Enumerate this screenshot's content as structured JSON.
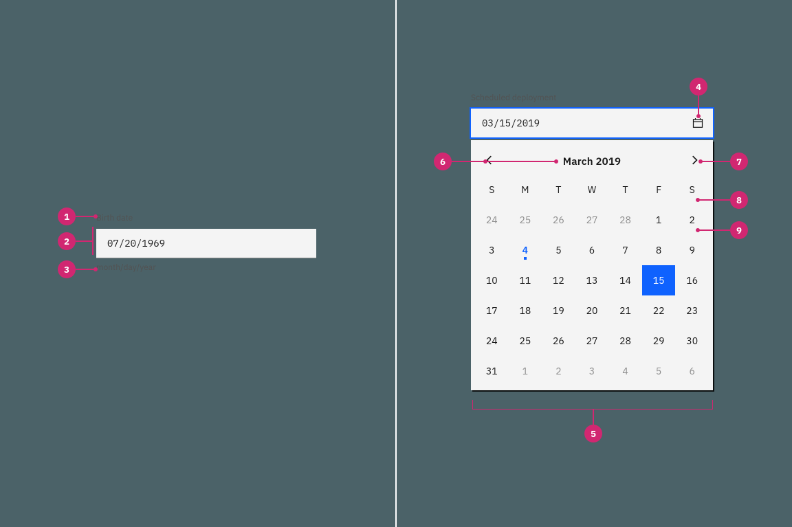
{
  "left": {
    "label": "Birth date",
    "value": "07/20/1969",
    "helper": "month/day/year"
  },
  "right": {
    "label": "Scheduled deployment",
    "value": "03/15/2019",
    "month_title": "March  2019",
    "weekdays": [
      "S",
      "M",
      "T",
      "W",
      "T",
      "F",
      "S"
    ],
    "days": [
      {
        "n": "24",
        "out": true
      },
      {
        "n": "25",
        "out": true
      },
      {
        "n": "26",
        "out": true
      },
      {
        "n": "27",
        "out": true
      },
      {
        "n": "28",
        "out": true
      },
      {
        "n": "1"
      },
      {
        "n": "2"
      },
      {
        "n": "3"
      },
      {
        "n": "4",
        "today": true
      },
      {
        "n": "5"
      },
      {
        "n": "6"
      },
      {
        "n": "7"
      },
      {
        "n": "8"
      },
      {
        "n": "9"
      },
      {
        "n": "10"
      },
      {
        "n": "11"
      },
      {
        "n": "12"
      },
      {
        "n": "13"
      },
      {
        "n": "14"
      },
      {
        "n": "15",
        "sel": true
      },
      {
        "n": "16"
      },
      {
        "n": "17"
      },
      {
        "n": "18"
      },
      {
        "n": "19"
      },
      {
        "n": "20"
      },
      {
        "n": "21"
      },
      {
        "n": "22"
      },
      {
        "n": "23"
      },
      {
        "n": "24"
      },
      {
        "n": "25"
      },
      {
        "n": "26"
      },
      {
        "n": "27"
      },
      {
        "n": "28"
      },
      {
        "n": "29"
      },
      {
        "n": "30"
      },
      {
        "n": "31"
      },
      {
        "n": "1",
        "out": true
      },
      {
        "n": "2",
        "out": true
      },
      {
        "n": "3",
        "out": true
      },
      {
        "n": "4",
        "out": true
      },
      {
        "n": "5",
        "out": true
      },
      {
        "n": "6",
        "out": true
      }
    ]
  },
  "annotations": {
    "1": "1",
    "2": "2",
    "3": "3",
    "4": "4",
    "5": "5",
    "6": "6",
    "7": "7",
    "8": "8",
    "9": "9"
  }
}
